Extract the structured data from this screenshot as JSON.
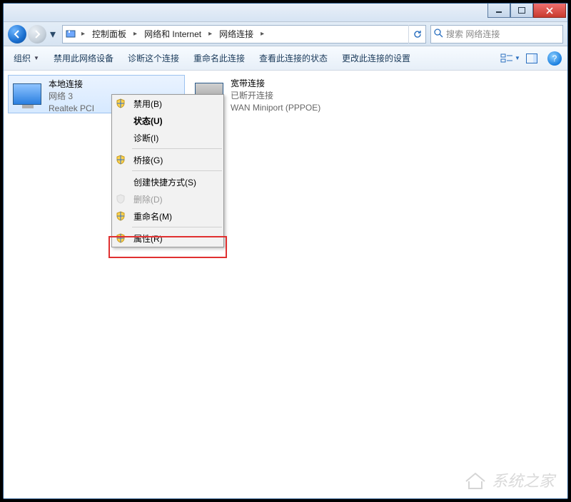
{
  "titlebar": {},
  "breadcrumb": {
    "seg1": "控制面板",
    "seg2": "网络和 Internet",
    "seg3": "网络连接"
  },
  "search": {
    "placeholder": "搜索 网络连接"
  },
  "toolbar": {
    "organize": "组织",
    "disable": "禁用此网络设备",
    "diagnose": "诊断这个连接",
    "rename": "重命名此连接",
    "status": "查看此连接的状态",
    "settings": "更改此连接的设置"
  },
  "connections": [
    {
      "title": "本地连接",
      "sub1": "网络  3",
      "sub2": "Realtek PCI"
    },
    {
      "title": "宽带连接",
      "sub1": "已断开连接",
      "sub2": "WAN Miniport (PPPOE)"
    }
  ],
  "context_menu": {
    "disable": "禁用(B)",
    "status": "状态(U)",
    "diagnose": "诊断(I)",
    "bridge": "桥接(G)",
    "shortcut": "创建快捷方式(S)",
    "delete": "删除(D)",
    "rename": "重命名(M)",
    "properties": "属性(R)"
  },
  "watermark": "系统之家"
}
